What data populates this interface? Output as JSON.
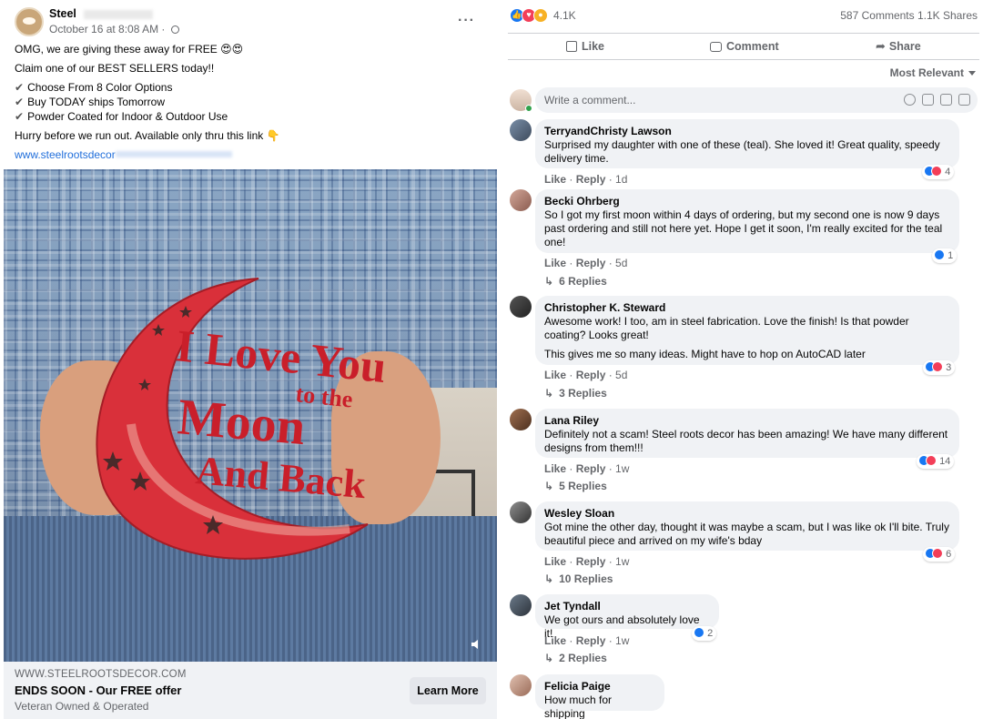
{
  "post": {
    "page_name": "Steel",
    "date": "October 16 at 8:08 AM · ",
    "line1": "OMG, we are giving these away for FREE 😍😍",
    "line2": "Claim one of our BEST SELLERS today!!",
    "bullets": [
      "Choose From 8 Color Options",
      "Buy TODAY ships Tomorrow",
      "Powder Coated for Indoor & Outdoor Use"
    ],
    "check_glyph": "✔",
    "line3": "Hurry before we run out. Available only thru this link 👇",
    "link": "www.steelrootsdecor",
    "more_glyph": "···",
    "image_text": [
      "I Love You",
      "to the",
      "Moon",
      "And Back"
    ],
    "ad": {
      "domain": "WWW.STEELROOTSDECOR.COM",
      "title": "ENDS SOON - Our FREE offer",
      "subtitle": "Veteran Owned & Operated",
      "button": "Learn More"
    }
  },
  "stats": {
    "reaction_count": "4.1K",
    "counts": "587 Comments  1.1K Shares",
    "colors": {
      "like": "#1877f2",
      "love": "#f33e58",
      "wow": "#f7b125"
    }
  },
  "actions": {
    "like": "Like",
    "comment": "Comment",
    "share": "Share"
  },
  "sort_label": "Most Relevant",
  "write_placeholder": "Write a comment...",
  "comments": [
    {
      "name": "TerryandChristy Lawson",
      "text": [
        "Surprised my daughter with one of these (teal). She loved it! Great quality, speedy",
        "delivery time."
      ],
      "like": "Like",
      "reply": "Reply",
      "time": "1d",
      "react_count": "4",
      "replies": ""
    },
    {
      "name": "Becki Ohrberg",
      "text": [
        "So I got my first moon within 4 days of ordering, but my second one is now 9 days",
        "past ordering and still not here yet. Hope I get it soon, I'm really excited for the teal",
        "one!"
      ],
      "like": "Like",
      "reply": "Reply",
      "time": "5d",
      "react_count": "1",
      "replies": "6 Replies"
    },
    {
      "name": "Christopher K. Steward",
      "text": [
        "Awesome work! I too, am in steel fabrication. Love the finish! Is that powder",
        "coating? Looks great!"
      ],
      "text2": "This gives me so many ideas. Might have to hop on AutoCAD later",
      "like": "Like",
      "reply": "Reply",
      "time": "5d",
      "react_count": "3",
      "replies": "3 Replies"
    },
    {
      "name": "Lana Riley",
      "text": [
        "Definitely not a scam! Steel roots decor has been amazing! We have many different",
        "designs from them!!!"
      ],
      "like": "Like",
      "reply": "Reply",
      "time": "1w",
      "react_count": "14",
      "replies": "5 Replies"
    },
    {
      "name": "Wesley Sloan",
      "text": [
        "Got mine the other day, thought it was maybe a scam, but I was like ok I'll bite. Truly",
        "beautiful piece and arrived on my wife's bday"
      ],
      "like": "Like",
      "reply": "Reply",
      "time": "1w",
      "react_count": "6",
      "replies": "10 Replies"
    },
    {
      "name": "Jet Tyndall",
      "text": [
        "We got ours and absolutely love it!"
      ],
      "like": "Like",
      "reply": "Reply",
      "time": "1w",
      "react_count": "2",
      "replies": "2 Replies"
    },
    {
      "name": "Felicia Paige",
      "text": [
        "How much for shipping"
      ]
    }
  ]
}
